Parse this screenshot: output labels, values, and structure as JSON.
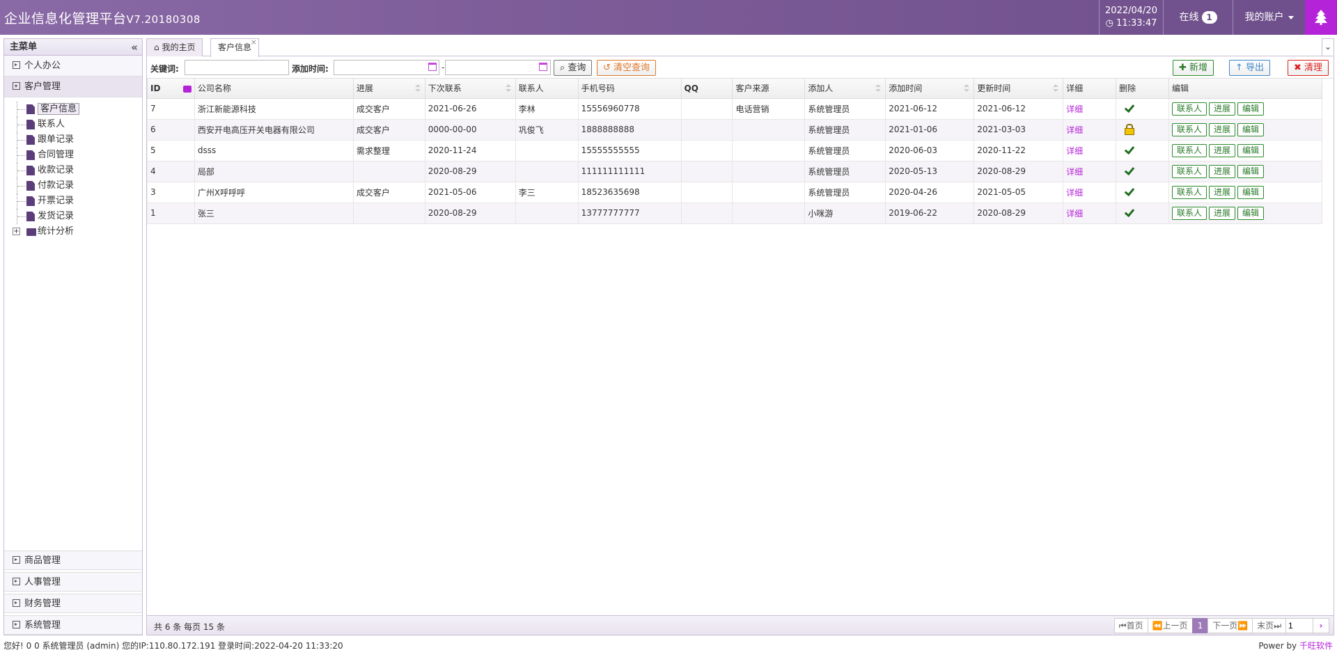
{
  "header": {
    "title": "企业信息化管理平台",
    "version": "V7.20180308",
    "date": "2022/04/20",
    "time": "11:33:47",
    "online_label": "在线",
    "online_count": "1",
    "account_label": "我的账户"
  },
  "sidebar": {
    "title": "主菜单",
    "sections": {
      "office": "个人办公",
      "customer": "客户管理",
      "goods": "商品管理",
      "hr": "人事管理",
      "finance": "财务管理",
      "system": "系统管理"
    },
    "tree": [
      "客户信息",
      "联系人",
      "跟单记录",
      "合同管理",
      "收款记录",
      "付款记录",
      "开票记录",
      "发货记录"
    ],
    "tree_folder": "统计分析"
  },
  "tabs": {
    "home": "我的主页",
    "customer": "客户信息"
  },
  "toolbar": {
    "keyword_label": "关键词:",
    "keyword_value": "",
    "addtime_label": "添加时间:",
    "date_sep": "-",
    "search_btn": "查询",
    "clear_btn": "清空查询",
    "add_btn": "新增",
    "export_btn": "导出",
    "purge_btn": "清理"
  },
  "table": {
    "columns": [
      "ID",
      "公司名称",
      "进展",
      "下次联系",
      "联系人",
      "手机号码",
      "QQ",
      "客户来源",
      "添加人",
      "添加时间",
      "更新时间",
      "详细",
      "删除",
      "编辑"
    ],
    "detail_label": "详细",
    "action_labels": [
      "联系人",
      "进展",
      "编辑"
    ],
    "rows": [
      {
        "id": "7",
        "company": "浙江新能源科技",
        "progress": "成交客户",
        "next": "2021-06-26",
        "contact": "李林",
        "phone": "15556960778",
        "qq": "",
        "source": "电话营销",
        "adder": "系统管理员",
        "added": "2021-06-12",
        "updated": "2021-06-12",
        "delete_icon": "check-icon"
      },
      {
        "id": "6",
        "company": "西安开电高压开关电器有限公司",
        "progress": "成交客户",
        "next": "0000-00-00",
        "contact": "巩俊飞",
        "phone": "1888888888",
        "qq": "",
        "source": "",
        "adder": "系统管理员",
        "added": "2021-01-06",
        "updated": "2021-03-03",
        "delete_icon": "lock-icon"
      },
      {
        "id": "5",
        "company": "dsss",
        "progress": "需求整理",
        "next": "2020-11-24",
        "contact": "",
        "phone": "15555555555",
        "qq": "",
        "source": "",
        "adder": "系统管理员",
        "added": "2020-06-03",
        "updated": "2020-11-22",
        "delete_icon": "check-icon"
      },
      {
        "id": "4",
        "company": "局部",
        "progress": "",
        "next": "2020-08-29",
        "contact": "",
        "phone": "111111111111",
        "qq": "",
        "source": "",
        "adder": "系统管理员",
        "added": "2020-05-13",
        "updated": "2020-08-29",
        "delete_icon": "check-icon"
      },
      {
        "id": "3",
        "company": "广州X呼呼呼",
        "progress": "成交客户",
        "next": "2021-05-06",
        "contact": "李三",
        "phone": "18523635698",
        "qq": "",
        "source": "",
        "adder": "系统管理员",
        "added": "2020-04-26",
        "updated": "2021-05-05",
        "delete_icon": "check-icon"
      },
      {
        "id": "1",
        "company": "张三",
        "progress": "",
        "next": "2020-08-29",
        "contact": "",
        "phone": "13777777777",
        "qq": "",
        "source": "",
        "adder": "小咪游",
        "added": "2019-06-22",
        "updated": "2020-08-29",
        "delete_icon": "check-icon"
      }
    ]
  },
  "pager": {
    "summary": "共 6 条 每页 15 条",
    "first": "首页",
    "prev": "上一页",
    "current": "1",
    "next": "下一页",
    "last": "末页",
    "page_input": "1"
  },
  "status": {
    "text": "您好! 0 0 系统管理员 (admin) 您的IP:110.80.172.191 登录时间:2022-04-20 11:33:20",
    "power_prefix": "Power by ",
    "power_link": "千旺软件"
  },
  "colors": {
    "header": "#7d5c98",
    "accent": "#b523d8",
    "green": "#2a7a2a"
  }
}
